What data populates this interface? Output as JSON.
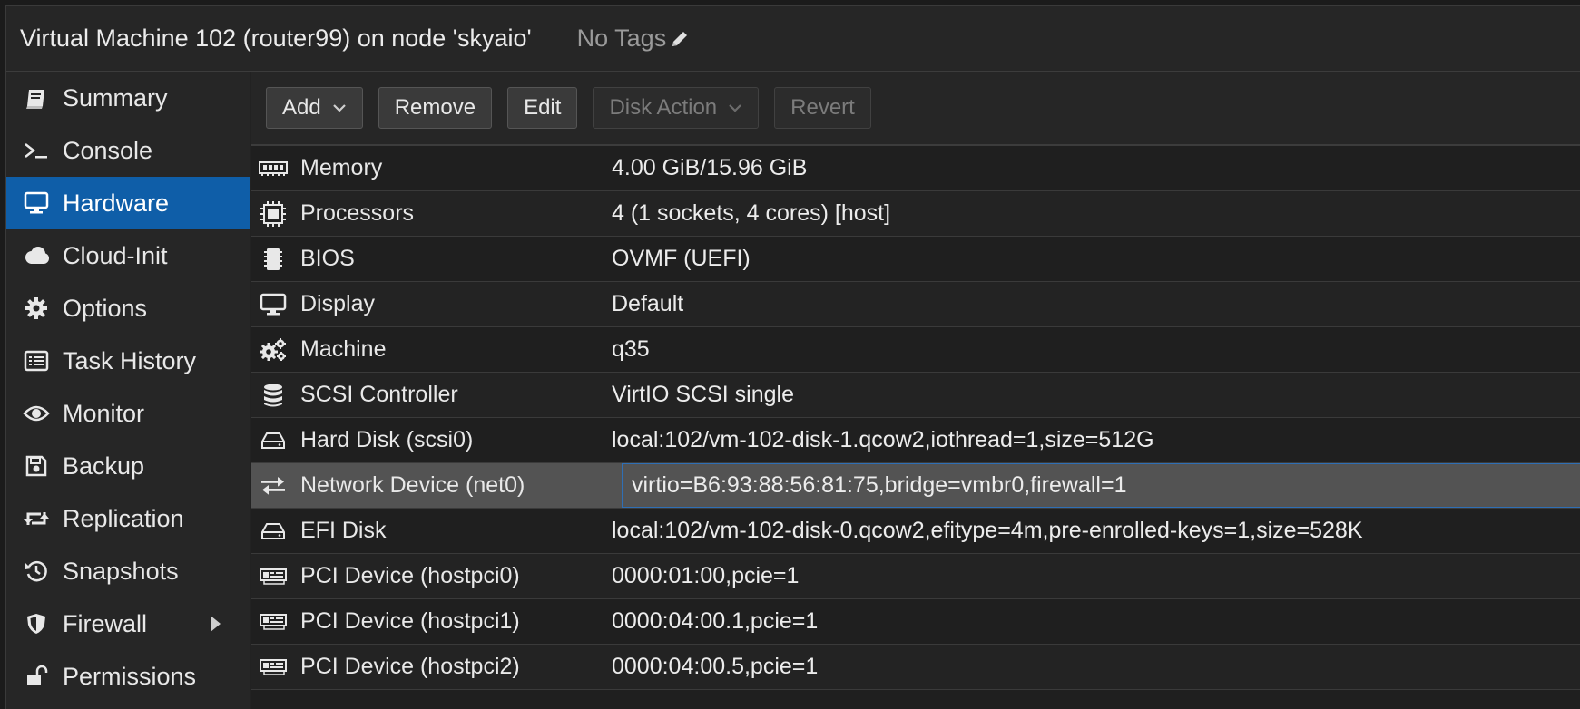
{
  "header": {
    "title": "Virtual Machine 102 (router99) on node 'skyaio'",
    "tags": "No Tags"
  },
  "sidebar": {
    "items": [
      {
        "label": "Summary",
        "icon": "book-icon",
        "active": false
      },
      {
        "label": "Console",
        "icon": "terminal-icon",
        "active": false
      },
      {
        "label": "Hardware",
        "icon": "desktop-icon",
        "active": true
      },
      {
        "label": "Cloud-Init",
        "icon": "cloud-icon",
        "active": false
      },
      {
        "label": "Options",
        "icon": "gear-icon",
        "active": false
      },
      {
        "label": "Task History",
        "icon": "list-icon",
        "active": false
      },
      {
        "label": "Monitor",
        "icon": "eye-icon",
        "active": false
      },
      {
        "label": "Backup",
        "icon": "floppy-icon",
        "active": false
      },
      {
        "label": "Replication",
        "icon": "retweet-icon",
        "active": false
      },
      {
        "label": "Snapshots",
        "icon": "history-icon",
        "active": false
      },
      {
        "label": "Firewall",
        "icon": "shield-icon",
        "active": false
      },
      {
        "label": "Permissions",
        "icon": "unlock-icon",
        "active": false
      }
    ]
  },
  "toolbar": {
    "add": "Add",
    "remove": "Remove",
    "edit": "Edit",
    "disk_action": "Disk Action",
    "revert": "Revert"
  },
  "hardware": {
    "rows": [
      {
        "name": "Memory",
        "value": "4.00 GiB/15.96 GiB",
        "icon": "memory-icon"
      },
      {
        "name": "Processors",
        "value": "4 (1 sockets, 4 cores) [host]",
        "icon": "cpu-icon"
      },
      {
        "name": "BIOS",
        "value": "OVMF (UEFI)",
        "icon": "microchip-icon"
      },
      {
        "name": "Display",
        "value": "Default",
        "icon": "desktop-icon"
      },
      {
        "name": "Machine",
        "value": "q35",
        "icon": "cogs-icon"
      },
      {
        "name": "SCSI Controller",
        "value": "VirtIO SCSI single",
        "icon": "database-icon"
      },
      {
        "name": "Hard Disk (scsi0)",
        "value": "local:102/vm-102-disk-1.qcow2,iothread=1,size=512G",
        "icon": "hdd-icon"
      },
      {
        "name": "Network Device (net0)",
        "value": "virtio=B6:93:88:56:81:75,bridge=vmbr0,firewall=1",
        "icon": "exchange-icon"
      },
      {
        "name": "EFI Disk",
        "value": "local:102/vm-102-disk-0.qcow2,efitype=4m,pre-enrolled-keys=1,size=528K",
        "icon": "hdd-icon"
      },
      {
        "name": "PCI Device (hostpci0)",
        "value": "0000:01:00,pcie=1",
        "icon": "pci-card-icon"
      },
      {
        "name": "PCI Device (hostpci1)",
        "value": "0000:04:00.1,pcie=1",
        "icon": "pci-card-icon"
      },
      {
        "name": "PCI Device (hostpci2)",
        "value": "0000:04:00.5,pcie=1",
        "icon": "pci-card-icon"
      }
    ],
    "selected_row": "Network Device (net0)"
  }
}
